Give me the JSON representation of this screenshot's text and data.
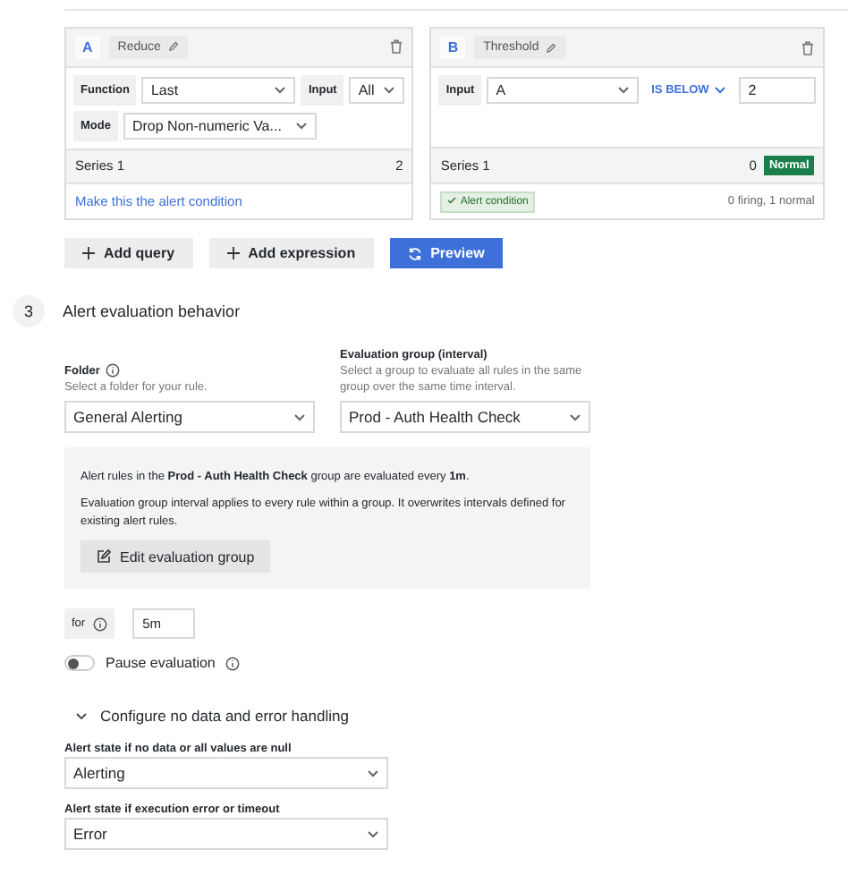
{
  "queries": [
    {
      "letter": "A",
      "name": "Reduce",
      "rows": [
        [
          {
            "kind": "label",
            "text": "Function"
          },
          {
            "kind": "select",
            "value": "Last"
          },
          {
            "kind": "label",
            "text": "Input"
          },
          {
            "kind": "select",
            "value": "All"
          }
        ],
        [
          {
            "kind": "label",
            "text": "Mode"
          },
          {
            "kind": "select",
            "value": "Drop Non-numeric Va..."
          }
        ]
      ],
      "series": {
        "name": "Series 1",
        "value": "2"
      },
      "footer": {
        "kind": "link",
        "text": "Make this the alert condition"
      }
    },
    {
      "letter": "B",
      "name": "Threshold",
      "rows": [
        [
          {
            "kind": "label",
            "text": "Input"
          },
          {
            "kind": "select",
            "value": "A"
          },
          {
            "kind": "operator",
            "value": "IS BELOW"
          },
          {
            "kind": "input",
            "value": "2"
          }
        ]
      ],
      "series": {
        "name": "Series 1",
        "value": "0",
        "badge": "Normal"
      },
      "footer": {
        "kind": "condition",
        "text": "Alert condition",
        "summary": "0 firing, 1 normal"
      }
    }
  ],
  "buttons": [
    {
      "kind": "add",
      "label": "Add query"
    },
    {
      "kind": "add",
      "label": "Add expression"
    },
    {
      "kind": "primary",
      "label": "Preview"
    }
  ],
  "section": {
    "number": "3",
    "title": "Alert evaluation behavior"
  },
  "folder": {
    "label": "Folder",
    "description": "Select a folder for your rule.",
    "value": "General Alerting"
  },
  "evaluation_group": {
    "label": "Evaluation group (interval)",
    "description": "Select a group to evaluate all rules in the same group over the same time interval.",
    "value": "Prod - Auth Health Check"
  },
  "info": {
    "text": "Alert rules in the **Prod - Auth Health Check** group are evaluated every **1m**.",
    "detail": "Evaluation group interval applies to every rule within a group. It overwrites intervals defined for existing alert rules.",
    "button": "Edit evaluation group"
  },
  "pending": {
    "label": "for",
    "value": "5m"
  },
  "pause": {
    "label": "Pause evaluation",
    "on": false
  },
  "error_handling": {
    "title": "Configure no data and error handling",
    "expanded": true,
    "fields": [
      {
        "label": "Alert state if no data or all values are null",
        "value": "Alerting"
      },
      {
        "label": "Alert state if execution error or timeout",
        "value": "Error"
      }
    ]
  }
}
